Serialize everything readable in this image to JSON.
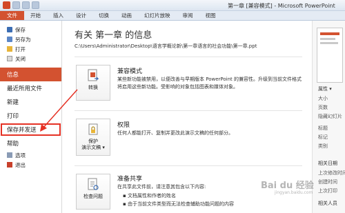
{
  "window": {
    "title": "第一章 [兼容模式] - Microsoft PowerPoint"
  },
  "ribbon_tabs": [
    "文件",
    "开始",
    "插入",
    "设计",
    "切换",
    "动画",
    "幻灯片放映",
    "审阅",
    "视图"
  ],
  "nav": {
    "small_top": [
      {
        "label": "保存",
        "icon": "save-icon"
      },
      {
        "label": "另存为",
        "icon": "save-as-icon"
      },
      {
        "label": "打开",
        "icon": "open-folder-icon"
      },
      {
        "label": "关闭",
        "icon": "close-file-icon"
      }
    ],
    "info": "信息",
    "recent": "最近所用文件",
    "new": "新建",
    "print": "打印",
    "save_send": "保存并发送",
    "help": "帮助",
    "options": {
      "label": "选项",
      "icon": "options-icon"
    },
    "exit": {
      "label": "退出",
      "icon": "exit-icon"
    }
  },
  "main": {
    "title": "有关 第一章 的信息",
    "path": "C:\\Users\\Administrator\\Desktop\\语言学概论新\\第一章语言的社会功能\\第一章.ppt",
    "sections": [
      {
        "button": "转换",
        "title": "兼容模式",
        "text": "某些新功能被禁用，以便改善与早期版本 PowerPoint 的兼容性。升级到当前文件格式将启用这些新功能。受影响的对象包括图表和媒体对象。"
      },
      {
        "button_line1": "保护",
        "button_line2": "演示文稿 ▾",
        "title": "权限",
        "text": "任何人都能打开、复制并更改此演示文稿的任何部分。"
      },
      {
        "button": "检查问题",
        "title": "准备共享",
        "text": "在共享此文件前，请注意其包含以下内容:",
        "bullets": [
          "文档属性和作者的姓名",
          "由于当前文件类型而无法检查辅助功能问题的内容"
        ]
      }
    ]
  },
  "right": {
    "properties_label": "属性 ▾",
    "rows": [
      "大小",
      "页数",
      "隐藏幻灯片",
      "标题",
      "标记",
      "类别"
    ],
    "dates_label": "相关日期",
    "date_rows": [
      "上次修改时间",
      "创建时间",
      "上次打印"
    ],
    "people_label": "相关人员"
  },
  "watermark": {
    "brand": "Bai du 经验",
    "url": "jingyan.baidu.com"
  },
  "colors": {
    "accent": "#d35230",
    "highlight_box": "#e53124"
  }
}
